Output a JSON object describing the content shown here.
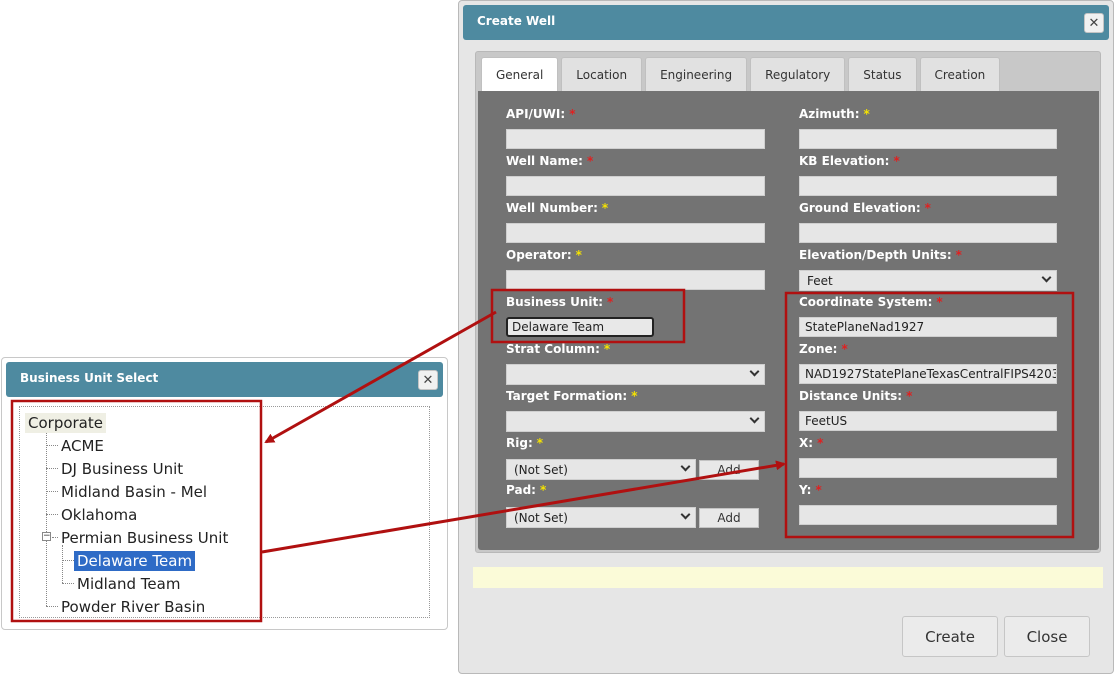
{
  "create_well": {
    "title": "Create Well",
    "close_symbol": "✕",
    "tabs": [
      {
        "label": "General",
        "active": true
      },
      {
        "label": "Location"
      },
      {
        "label": "Engineering"
      },
      {
        "label": "Regulatory"
      },
      {
        "label": "Status"
      },
      {
        "label": "Creation"
      }
    ],
    "required_marker": "*",
    "fields": {
      "api_uwi": {
        "label": "API/UWI:",
        "value": ""
      },
      "well_name": {
        "label": "Well Name:",
        "value": ""
      },
      "well_number": {
        "label": "Well Number:",
        "value": ""
      },
      "operator": {
        "label": "Operator:",
        "value": ""
      },
      "business_unit": {
        "label": "Business Unit:",
        "value": "Delaware Team"
      },
      "strat_column": {
        "label": "Strat Column:",
        "value": ""
      },
      "target_formation": {
        "label": "Target Formation:",
        "value": ""
      },
      "rig": {
        "label": "Rig:",
        "value": "(Not Set)",
        "add_label": "Add"
      },
      "pad": {
        "label": "Pad:",
        "value": "(Not Set)",
        "add_label": "Add"
      },
      "azimuth": {
        "label": "Azimuth:",
        "value": ""
      },
      "kb_elevation": {
        "label": "KB Elevation:",
        "value": ""
      },
      "ground_elevation": {
        "label": "Ground Elevation:",
        "value": ""
      },
      "elevation_units": {
        "label": "Elevation/Depth Units:",
        "value": "Feet"
      },
      "coordinate_system": {
        "label": "Coordinate System:",
        "value": "StatePlaneNad1927"
      },
      "zone": {
        "label": "Zone:",
        "value": "NAD1927StatePlaneTexasCentralFIPS4203"
      },
      "distance_units": {
        "label": "Distance Units:",
        "value": "FeetUS"
      },
      "x": {
        "label": "X:",
        "value": ""
      },
      "y": {
        "label": "Y:",
        "value": ""
      }
    },
    "buttons": {
      "create": "Create",
      "close": "Close"
    }
  },
  "business_unit_select": {
    "title": "Business Unit Select",
    "close_symbol": "✕",
    "tree": {
      "root": "Corporate",
      "children": [
        "ACME",
        "DJ Business Unit",
        "Midland Basin - Mel",
        "Oklahoma",
        "Permian Business Unit",
        "Powder River Basin"
      ],
      "expander_symbol": "−",
      "permian_children": [
        "Delaware Team",
        "Midland Team"
      ],
      "selected": "Delaware Team"
    }
  },
  "colors": {
    "header": "#4e8aa0",
    "form_panel": "#737373",
    "required_red": "#e02020",
    "required_yellow": "#f5e300",
    "selected_node": "#2e6bc6",
    "callout": "#b01010"
  }
}
